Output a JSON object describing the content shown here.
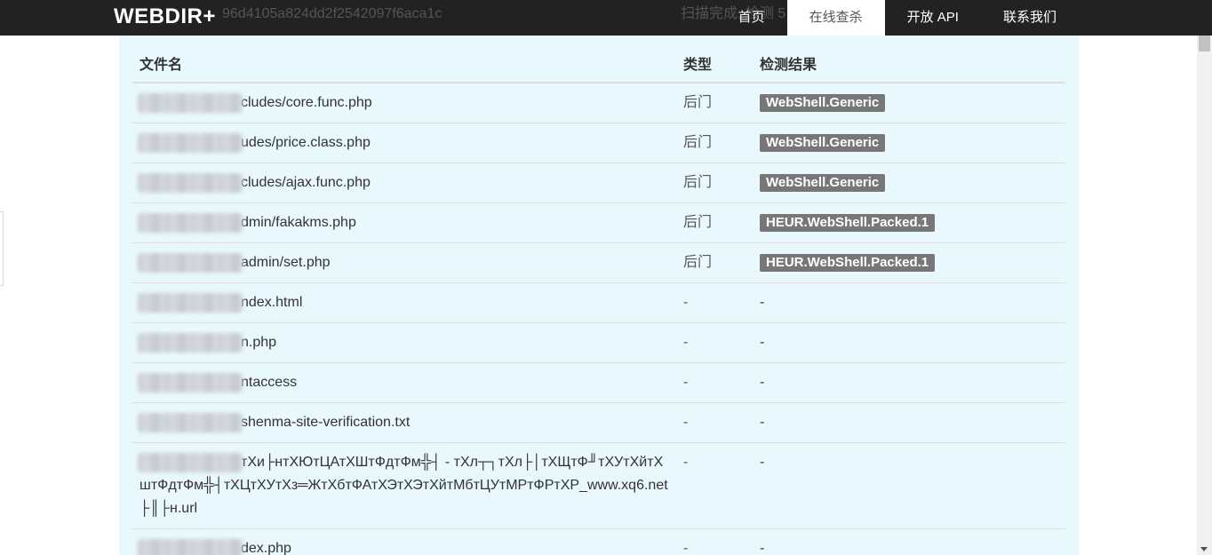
{
  "navbar": {
    "brand": "WEBDIR+",
    "hash_fragment": "96d4105a824dd2f2542097f6aca1c",
    "status_fragment": "扫描完成, 检测 5",
    "links": [
      {
        "label": "首页",
        "active": false
      },
      {
        "label": "在线查杀",
        "active": true
      },
      {
        "label": "开放 API",
        "active": false
      },
      {
        "label": "联系我们",
        "active": false
      }
    ]
  },
  "table": {
    "headers": {
      "filename": "文件名",
      "type": "类型",
      "result": "检测结果"
    },
    "rows": [
      {
        "filename": "cludes/core.func.php",
        "type": "后门",
        "result": "WebShell.Generic"
      },
      {
        "filename": "udes/price.class.php",
        "type": "后门",
        "result": "WebShell.Generic"
      },
      {
        "filename": "cludes/ajax.func.php",
        "type": "后门",
        "result": "WebShell.Generic"
      },
      {
        "filename": "dmin/fakakms.php",
        "type": "后门",
        "result": "HEUR.WebShell.Packed.1"
      },
      {
        "filename": "admin/set.php",
        "type": "后门",
        "result": "HEUR.WebShell.Packed.1"
      },
      {
        "filename": "ndex.html",
        "type": "-",
        "result": "-"
      },
      {
        "filename": "n.php",
        "type": "-",
        "result": "-"
      },
      {
        "filename": "ntaccess",
        "type": "-",
        "result": "-"
      },
      {
        "filename": "shenma-site-verification.txt",
        "type": "-",
        "result": "-"
      },
      {
        "filename": "тХи├нтХЮтЦАтХШтФдтФм╬┤ - тХл┬┐тХл├│тХЩтФ╜тХУтХйтХштФдтФм╬┤тХЦтХУтХз═ЖтХбтФАтХЭтХЭтХйтМбтЦУтМРтФРтХР_www.xq6.net├║├н.url",
        "type": "-",
        "result": "-"
      },
      {
        "filename": "dex.php",
        "type": "-",
        "result": "-"
      }
    ]
  },
  "colors": {
    "navbar_bg": "#222222",
    "panel_bg": "#e8f8fd",
    "label_bg": "#777777"
  }
}
